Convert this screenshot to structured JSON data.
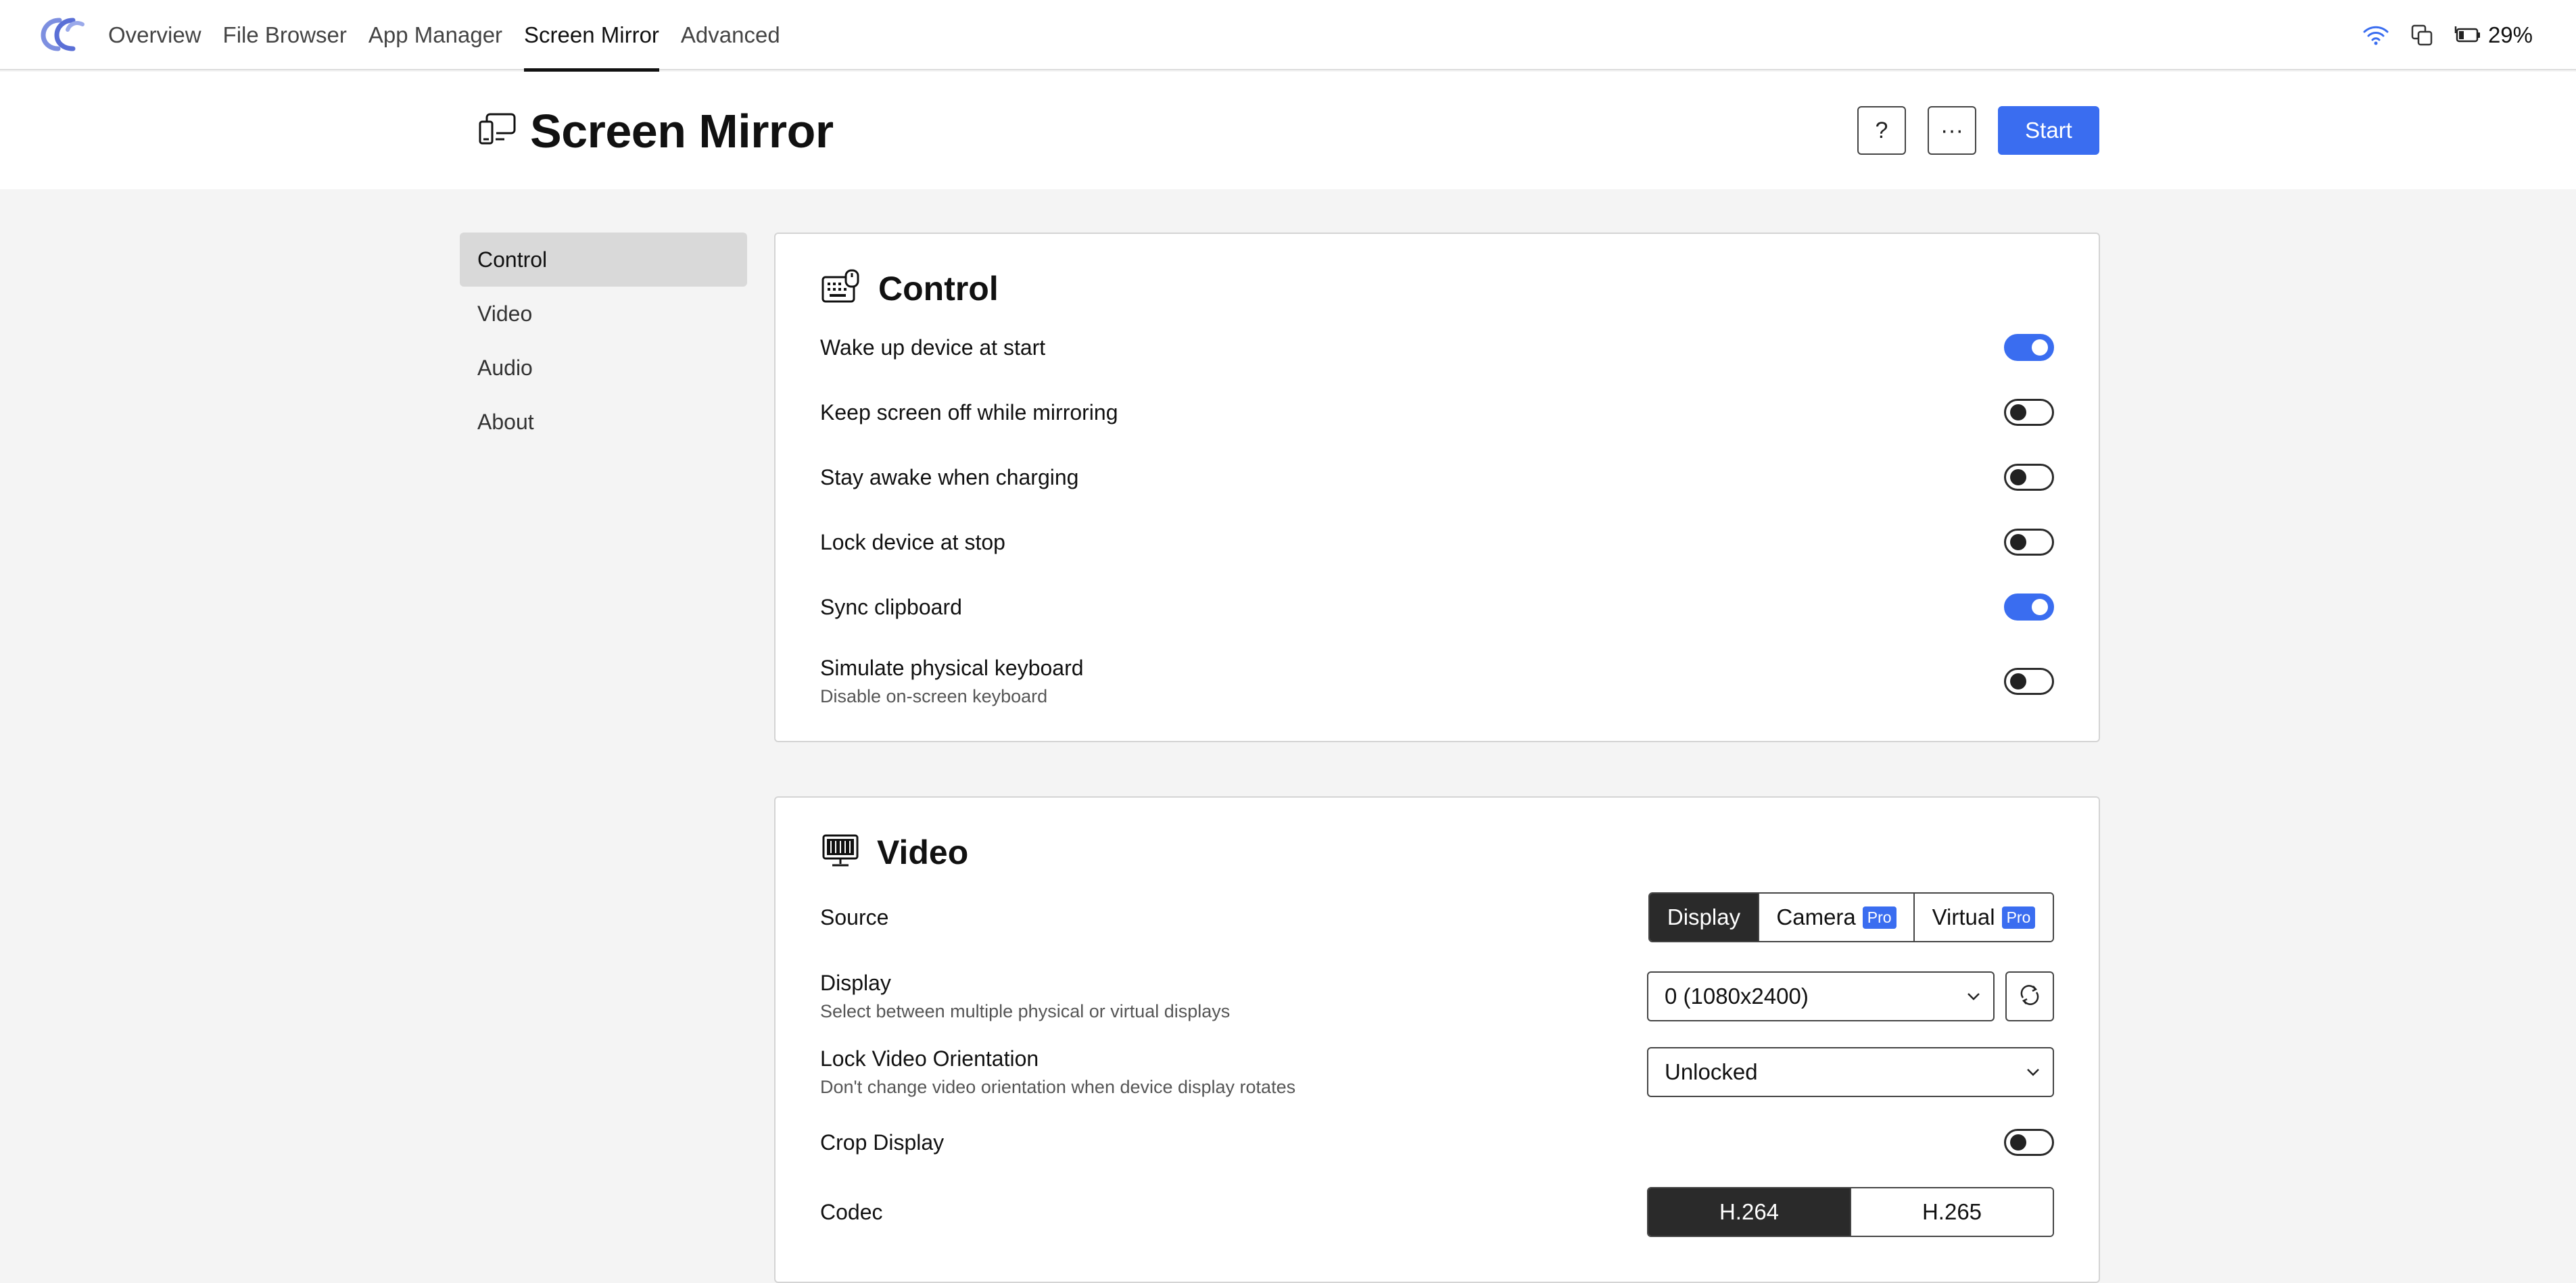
{
  "app": {
    "nav_tabs": [
      {
        "label": "Overview"
      },
      {
        "label": "File Browser"
      },
      {
        "label": "App Manager"
      },
      {
        "label": "Screen Mirror"
      },
      {
        "label": "Advanced"
      }
    ],
    "active_tab": "Screen Mirror",
    "status": {
      "battery_percent": "29%",
      "icons": [
        "wifi-icon",
        "copy-windows-icon",
        "battery-charging-icon"
      ]
    },
    "accent_color": "#3a6df0"
  },
  "header": {
    "title": "Screen Mirror",
    "help_label": "?",
    "more_label": "···",
    "start_label": "Start"
  },
  "side_menu": {
    "items": [
      {
        "label": "Control",
        "active": true
      },
      {
        "label": "Video",
        "active": false
      },
      {
        "label": "Audio",
        "active": false
      },
      {
        "label": "About",
        "active": false
      }
    ]
  },
  "control": {
    "title": "Control",
    "settings": [
      {
        "label": "Wake up device at start",
        "on": true
      },
      {
        "label": "Keep screen off while mirroring",
        "on": false
      },
      {
        "label": "Stay awake when charging",
        "on": false
      },
      {
        "label": "Lock device at stop",
        "on": false
      },
      {
        "label": "Sync clipboard",
        "on": true
      },
      {
        "label": "Simulate physical keyboard",
        "description": "Disable on-screen keyboard",
        "on": false
      }
    ]
  },
  "video": {
    "title": "Video",
    "source": {
      "label": "Source",
      "options": [
        {
          "label": "Display",
          "active": true,
          "badge": ""
        },
        {
          "label": "Camera",
          "active": false,
          "badge": "Pro"
        },
        {
          "label": "Virtual",
          "active": false,
          "badge": "Pro"
        }
      ]
    },
    "display": {
      "label": "Display",
      "description": "Select between multiple physical or virtual displays",
      "value": "0 (1080x2400)"
    },
    "lock_orientation": {
      "label": "Lock Video Orientation",
      "description": "Don't change video orientation when device display rotates",
      "value": "Unlocked"
    },
    "crop_display": {
      "label": "Crop Display",
      "on": false
    },
    "codec": {
      "label": "Codec",
      "options": [
        {
          "label": "H.264",
          "active": true
        },
        {
          "label": "H.265",
          "active": false
        }
      ]
    }
  }
}
